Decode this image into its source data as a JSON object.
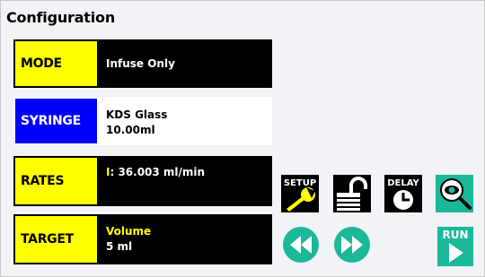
{
  "title": "Configuration",
  "rows": {
    "mode": {
      "label": "MODE",
      "value": "Infuse Only"
    },
    "syringe": {
      "label": "SYRINGE",
      "line1": "KDS Glass",
      "line2": "10.00ml"
    },
    "rates": {
      "label": "RATES",
      "prefix": "I",
      "value": ": 36.003 ml/min"
    },
    "target": {
      "label": "TARGET",
      "line1": "Volume",
      "line2": "5 ml"
    }
  },
  "buttons": {
    "setup": "SETUP",
    "delay": "DELAY",
    "run": "RUN"
  },
  "icons": [
    "wrench-icon",
    "padlock-icon",
    "clock-icon",
    "eye-magnifier-icon",
    "rewind-icon",
    "fast-forward-icon",
    "play-icon"
  ],
  "colors": {
    "yellow": "#ffff00",
    "blue": "#0000ff",
    "teal": "#1bb89a",
    "black": "#000000"
  }
}
